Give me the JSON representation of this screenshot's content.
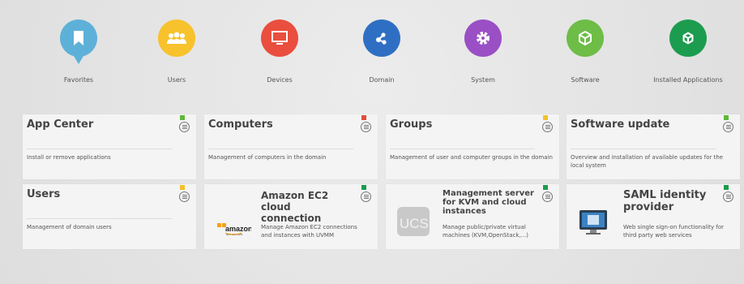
{
  "categories": [
    {
      "label": "Favorites",
      "icon": "bookmark-icon",
      "color": "#5db1d8"
    },
    {
      "label": "Users",
      "icon": "users-icon",
      "color": "#f7c22c"
    },
    {
      "label": "Devices",
      "icon": "monitor-icon",
      "color": "#ea4e3e"
    },
    {
      "label": "Domain",
      "icon": "domain-network-icon",
      "color": "#2f6fc3"
    },
    {
      "label": "System",
      "icon": "gear-icon",
      "color": "#9a4fc5"
    },
    {
      "label": "Software",
      "icon": "box-icon",
      "color": "#6dbd47"
    },
    {
      "label": "Installed Applications",
      "icon": "box-cube-icon",
      "color": "#1c9c4f"
    }
  ],
  "tiles": {
    "app_center": {
      "title": "App Center",
      "desc": "Install or remove applications",
      "flag_color": "#5eb83a"
    },
    "computers": {
      "title": "Computers",
      "desc": "Management of computers in the domain",
      "flag_color": "#e24b3b"
    },
    "groups": {
      "title": "Groups",
      "desc": "Management of user and computer groups in the domain",
      "flag_color": "#f2c22a"
    },
    "software_update": {
      "title": "Software update",
      "desc": "Overview and installation of available updates for the local system",
      "flag_color": "#5eb83a"
    },
    "users": {
      "title": "Users",
      "desc": "Management of domain users",
      "flag_color": "#f2c22a"
    },
    "amazon_ec2": {
      "title": "Amazon EC2 cloud connection",
      "desc": "Manage Amazon EC2 connections and instances with UVMM",
      "flag_color": "#1c9c4f",
      "logo_text": "amazon",
      "logo_sub": "web services"
    },
    "uvmm": {
      "title": "Management server for KVM and cloud instances",
      "desc": "Manage public/private virtual machines (KVM,OpenStack,...)",
      "flag_color": "#1c9c4f",
      "logo_text": "UCS"
    },
    "saml": {
      "title": "SAML identity provider",
      "desc": "Web single sign-on functionality for third party web services",
      "flag_color": "#1c9c4f"
    }
  }
}
